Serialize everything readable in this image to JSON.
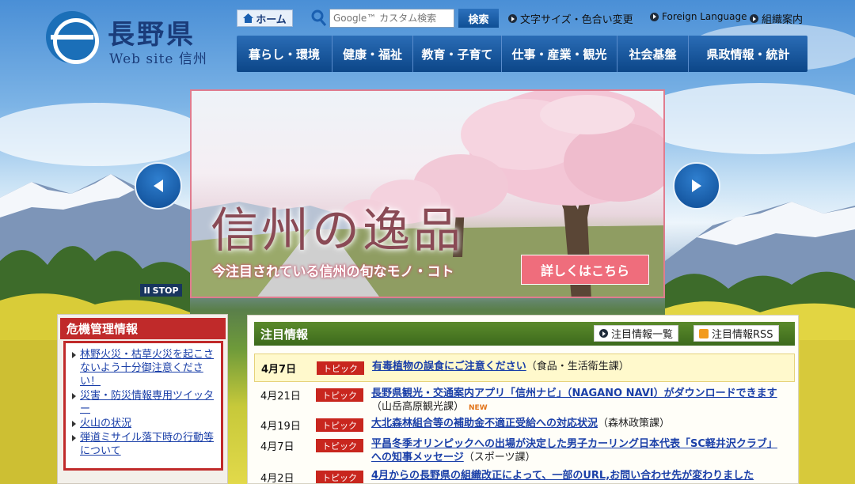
{
  "logo": {
    "title": "長野県",
    "subtitle": "Web site 信州"
  },
  "header": {
    "home_label": "ホーム",
    "search_placeholder": "Google™ カスタム検索",
    "search_button": "検索",
    "links": [
      "文字サイズ・色合い変更",
      "Foreign Language",
      "組織案内"
    ]
  },
  "gnav": [
    "暮らし・環境",
    "健康・福祉",
    "教育・子育て",
    "仕事・産業・観光",
    "社会基盤",
    "県政情報・統計"
  ],
  "slider": {
    "title": "信州の逸品",
    "subtitle": "今注目されている信州の旬なモノ・コト",
    "button": "詳しくはこちら",
    "stop_label": "STOP"
  },
  "crisis": {
    "title": "危機管理情報",
    "items": [
      "林野火災・枯草火災を起こさないよう十分御注意ください！",
      "災害・防災情報専用ツイッター",
      "火山の状況",
      "弾道ミサイル落下時の行動等について"
    ]
  },
  "news": {
    "title": "注目情報",
    "list_button": "注目情報一覧",
    "rss_button": "注目情報RSS",
    "items": [
      {
        "date": "4月7日",
        "tag": "トピック",
        "link": "有毒植物の誤食にご注意ください",
        "dept": "（食品・生活衛生課）",
        "new": ""
      },
      {
        "date": "4月21日",
        "tag": "トピック",
        "link": "長野県観光・交通案内アプリ「信州ナビ」（NAGANO NAVI）がダウンロードできます",
        "dept": "（山岳高原観光課）",
        "new": "NEW"
      },
      {
        "date": "4月19日",
        "tag": "トピック",
        "link": "大北森林組合等の補助金不適正受給への対応状況",
        "dept": "（森林政策課）",
        "new": ""
      },
      {
        "date": "4月7日",
        "tag": "トピック",
        "link": "平昌冬季オリンピックへの出場が決定した男子カーリング日本代表「SC軽井沢クラブ」への知事メッセージ",
        "dept": "（スポーツ課）",
        "new": ""
      },
      {
        "date": "4月2日",
        "tag": "トピック",
        "link": "4月からの長野県の組織改正によって、一部のURL,お問い合わせ先が変わりました",
        "dept": "",
        "new": ""
      }
    ]
  },
  "colors": {
    "brand_blue": "#0c4688",
    "alert_red": "#c02a2a",
    "news_green": "#4a7a23",
    "tag_red": "#c8261e"
  }
}
